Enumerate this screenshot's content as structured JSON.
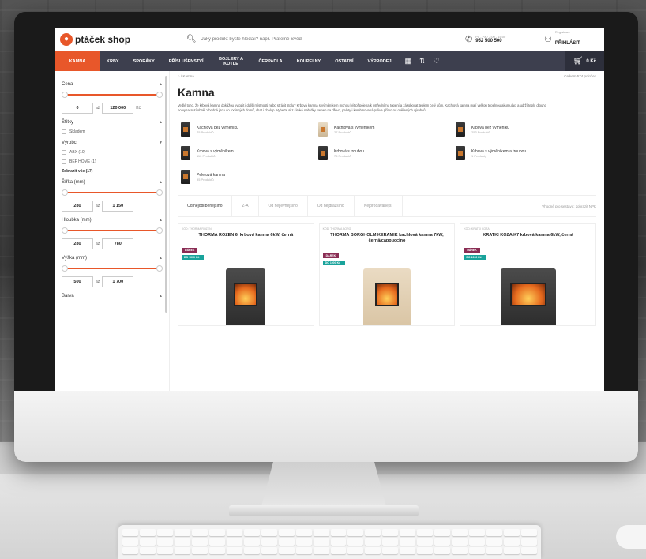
{
  "header": {
    "logo_text": "ptáček shop",
    "search_placeholder": "Jaký produkt byste hledali? např. Pratelné Švéd",
    "contact_small": "Po - Pá / 7:00 - 15:00",
    "contact_phone": "952 500 500",
    "login_small": "Registrace",
    "login_label": "PŘIHLÁSIT"
  },
  "nav": {
    "items": [
      "KAMNA",
      "KRBY",
      "SPORÁKY",
      "PŘÍSLUŠENSTVÍ",
      "BOJLERY A KOTLE",
      "ČERPADLA",
      "KOUPELNY",
      "OSTATNÍ",
      "VÝPRODEJ"
    ],
    "cart_total": "0 Kč"
  },
  "sidebar": {
    "price_label": "Cena",
    "price_min": "0",
    "price_max": "120 000",
    "price_unit": "Kč",
    "range_sep": "až",
    "stock_label": "Štítky",
    "stock_option": "Skladem",
    "manufacturer_label": "Výrobci",
    "manufacturers": [
      "ABX (10)",
      "BEF HOME (1)"
    ],
    "show_all": "Zobrazit vše (17)",
    "width_label": "Šířka (mm)",
    "width_min": "280",
    "width_max": "1 150",
    "depth_label": "Hloubka (mm)",
    "depth_min": "280",
    "depth_max": "780",
    "height_label": "Výška (mm)",
    "height_min": "500",
    "height_max": "1 700",
    "color_label": "Barva"
  },
  "main": {
    "breadcrumb": "/ Kamna",
    "total_products": "Celkem 574 položek",
    "title": "Kamna",
    "description": "Vedlé toho, že krbová kamna dokážou vytopit i další místnosti nebo strávit stolu? Krbová kamna s výměníkem mohou být připojena k ústřednímu topení a zásobovat teplem celý dům. Kachlová kamna mají velkou tepelnou akumulaci a udrží teplo dlouho po vyhasnutí ohně. Vhodná jsou do rodinných domů, chat i chalup. Vyberte si z široké nabídky kamen na dřevo, pelety i kombinovaná paliva přímo od ověřených výrobců.",
    "categories": [
      {
        "name": "Kachlová bez výměníku",
        "count": "75 Produktů"
      },
      {
        "name": "Kachlová s výměníkem",
        "count": "27 Produktů"
      },
      {
        "name": "Krbová bez výměníku",
        "count": "253 Produktů"
      },
      {
        "name": "Krbová s výměníkem",
        "count": "110 Produktů"
      },
      {
        "name": "Krbová s troubou",
        "count": "75 Produktů"
      },
      {
        "name": "Krbová s výměníkem a troubou",
        "count": "1 Produkty"
      },
      {
        "name": "Peletová kamna",
        "count": "95 Produktů"
      }
    ],
    "sort_tabs": [
      "Od nejoblíbenějšího",
      "Z-A",
      "Od nejlevnějšího",
      "Od nejdražšího",
      "Nejprodávanější"
    ],
    "sort_right": "Vhodné pro sestavu: zobrazit NPK",
    "products": [
      {
        "code": "KÓD: THORMA ROZEN",
        "name": "THORMA ROZEN 6I krbová kamna 6kW, černá",
        "gift": "DÁREK",
        "gift_value": "DO 1000 Kč"
      },
      {
        "code": "KÓD: THORMA BORG",
        "name": "THORMA BORGHOLM KERAMIK kachlová kamna 7kW, černá/cappuccino",
        "gift": "DÁREK",
        "gift_value": "DO 1000 Kč"
      },
      {
        "code": "KÓD: KRATKI KOZA",
        "name": "KRATKI KOZA K7 krbová kamna 6kW, černá",
        "gift": "DÁREK",
        "gift_value": "DO 1000 Kč"
      }
    ]
  }
}
